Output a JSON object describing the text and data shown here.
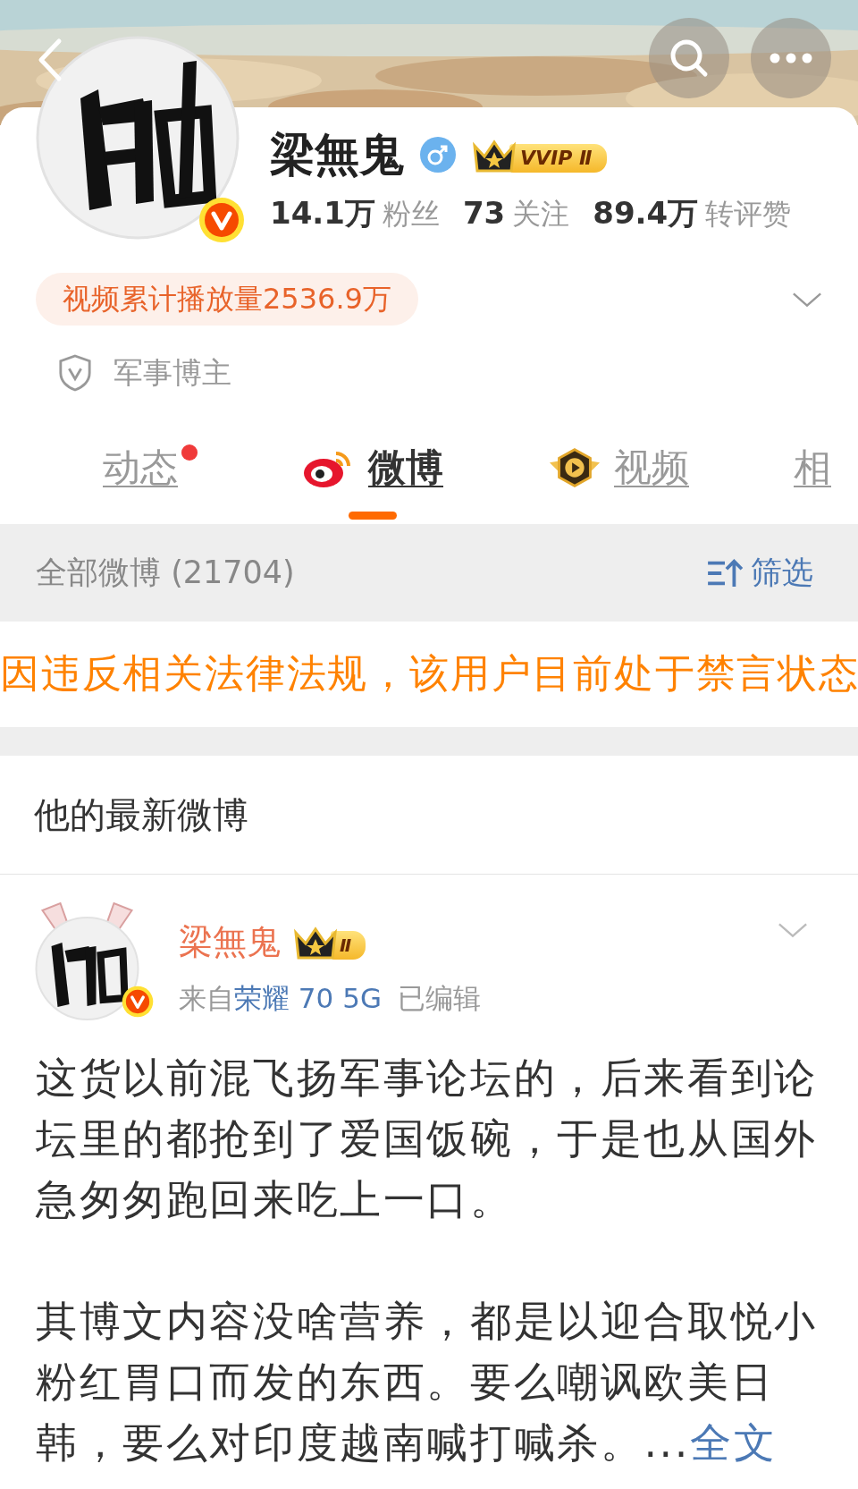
{
  "profile": {
    "name": "梁無鬼",
    "vip_badge": "VVIP Ⅱ",
    "stats": [
      {
        "count": "14.1万",
        "caption": "粉丝"
      },
      {
        "count": "73",
        "caption": "关注"
      },
      {
        "count": "89.4万",
        "caption": "转评赞"
      }
    ],
    "video_plays": "视频累计播放量2536.9万",
    "tag": "军事博主"
  },
  "tabs": [
    {
      "label": "动态",
      "selected": false,
      "dot": true,
      "kind": "plain"
    },
    {
      "label": "微博",
      "selected": true,
      "dot": false,
      "kind": "weibo"
    },
    {
      "label": "视频",
      "selected": false,
      "dot": false,
      "kind": "video"
    },
    {
      "label": "相",
      "selected": false,
      "dot": false,
      "kind": "plain"
    }
  ],
  "filter_bar": {
    "title": "全部微博 (21704)",
    "button": "筛选"
  },
  "notice": "因违反相关法律法规，该用户目前处于禁言状态",
  "section_title": "他的最新微博",
  "post": {
    "author": "梁無鬼",
    "badge": "Ⅱ",
    "source_prefix": "来自",
    "device": "荣耀 70 5G",
    "edited": "已编辑",
    "paragraphs": [
      "这货以前混飞扬军事论坛的，后来看到论坛里的都抢到了爱国饭碗，于是也从国外急匆匆跑回来吃上一口。",
      "其博文内容没啥营养，都是以迎合取悦小粉红胃口而发的东西。要么嘲讽欧美日韩，要么对印度越南喊打喊杀。..."
    ],
    "more_link": "全文"
  }
}
